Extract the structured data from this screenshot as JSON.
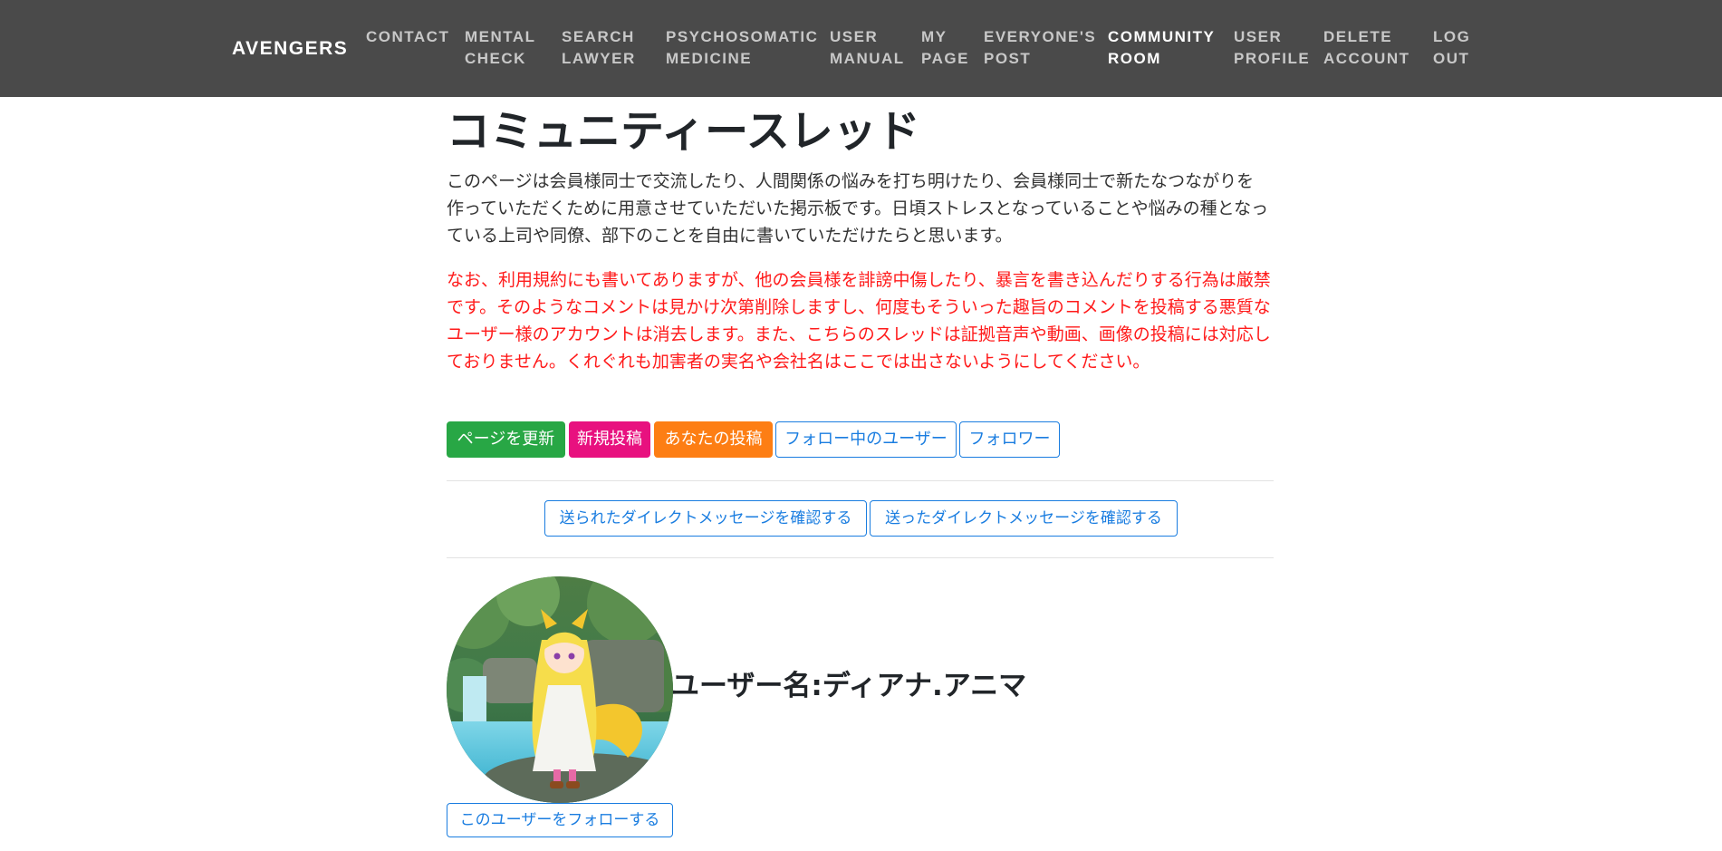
{
  "nav": {
    "brand": "AVENGERS",
    "links": [
      {
        "line1": "CONTACT",
        "line2": ""
      },
      {
        "line1": "MENTAL",
        "line2": "CHECK"
      },
      {
        "line1": "SEARCH",
        "line2": "LAWYER"
      },
      {
        "line1": "PSYCHOSOMATIC",
        "line2": "MEDICINE"
      },
      {
        "line1": "USER",
        "line2": "MANUAL"
      },
      {
        "line1": "MY",
        "line2": "PAGE"
      },
      {
        "line1": "EVERYONE'S",
        "line2": "POST"
      },
      {
        "line1": "COMMUNITY",
        "line2": "ROOM"
      },
      {
        "line1": "USER",
        "line2": "PROFILE"
      },
      {
        "line1": "DELETE",
        "line2": "ACCOUNT"
      },
      {
        "line1": "LOG",
        "line2": "OUT"
      }
    ],
    "active_index": 7
  },
  "main": {
    "title": "コミュニティースレッド",
    "intro": "このページは会員様同士で交流したり、人間関係の悩みを打ち明けたり、会員様同士で新たなつながりを作っていただくために用意させていただいた掲示板です。日頃ストレスとなっていることや悩みの種となっている上司や同僚、部下のことを自由に書いていただけたらと思います。",
    "warning": "なお、利用規約にも書いてありますが、他の会員様を誹謗中傷したり、暴言を書き込んだりする行為は厳禁です。そのようなコメントは見かけ次第削除しますし、何度もそういった趣旨のコメントを投稿する悪質なユーザー様のアカウントは消去します。また、こちらのスレッドは証拠音声や動画、画像の投稿には対応しておりません。くれぐれも加害者の実名や会社名はここでは出さないようにしてください。",
    "buttons": {
      "refresh": "ページを更新",
      "new_post": "新規投稿",
      "your_posts": "あなたの投稿",
      "following": "フォロー中のユーザー",
      "followers": "フォロワー"
    },
    "dm_buttons": {
      "received": "送られたダイレクトメッセージを確認する",
      "sent": "送ったダイレクトメッセージを確認する"
    },
    "user": {
      "name": "ユーザー名:ディアナ.アニマ",
      "follow": "このユーザーをフォローする"
    }
  },
  "colors": {
    "navbar_bg": "#4a4a4a",
    "refresh": "#28a745",
    "new_post": "#e8117f",
    "your_posts": "#fd7e14",
    "outline": "#1a7de0",
    "warning": "#ff1a1a"
  }
}
